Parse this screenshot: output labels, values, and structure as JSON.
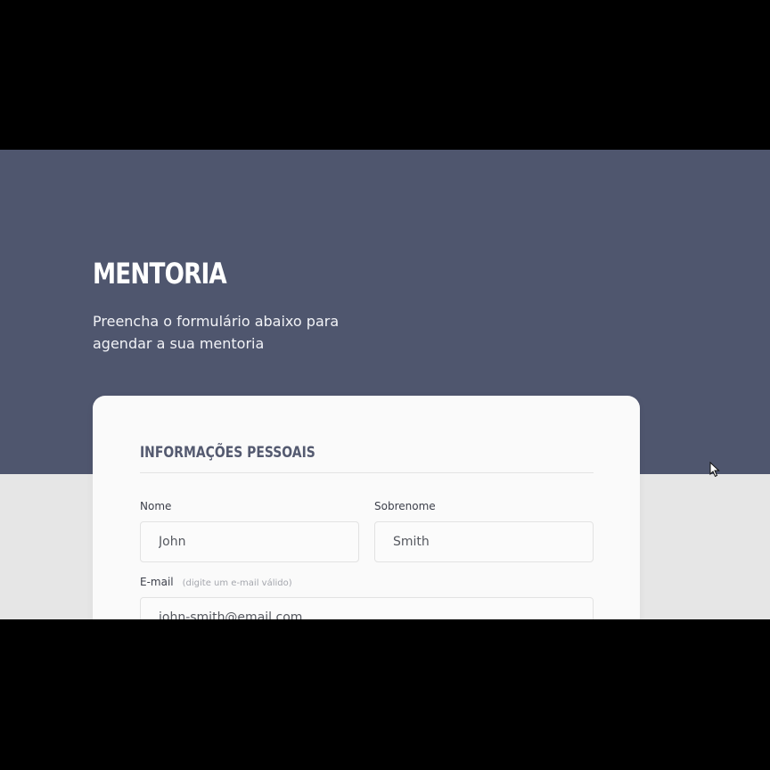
{
  "hero": {
    "title": "MENTORIA",
    "subtitle": "Preencha o formulário abaixo para agendar a sua mentoria"
  },
  "form": {
    "section_title": "INFORMAÇÕES PESSOAIS",
    "first_name": {
      "label": "Nome",
      "value": "John"
    },
    "last_name": {
      "label": "Sobrenome",
      "value": "Smith"
    },
    "email": {
      "label": "E-mail",
      "hint": "(digite um e-mail válido)",
      "value": "john-smith@email.com"
    }
  },
  "colors": {
    "hero_background": "#4f566e",
    "page_background": "#e6e6e6",
    "card_background": "#fafafa",
    "section_title": "#545a70"
  },
  "icons": {
    "cursor": "mouse-pointer-icon"
  }
}
